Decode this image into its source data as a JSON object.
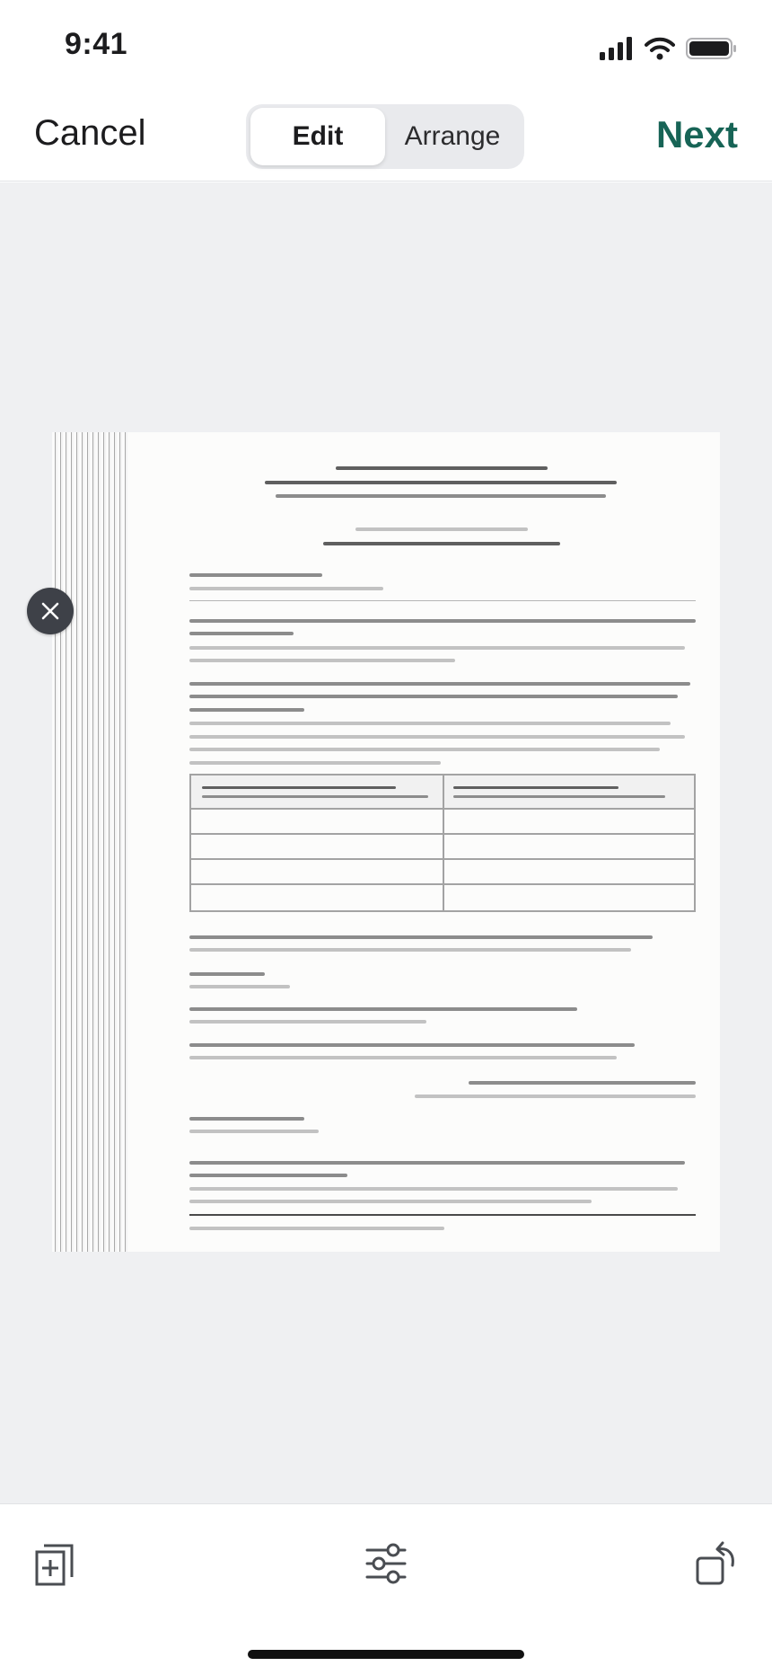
{
  "status_bar": {
    "time": "9:41"
  },
  "nav": {
    "cancel_label": "Cancel",
    "segments": [
      {
        "label": "Edit",
        "selected": true
      },
      {
        "label": "Arrange",
        "selected": false
      }
    ],
    "next_label": "Next",
    "accent_color": "#176456"
  },
  "scan_page": {
    "remove_icon": "close-icon",
    "content": "scanned document page (text not legible)"
  },
  "toolbar": {
    "icons": [
      "add-page-icon",
      "adjustments-icon",
      "rotate-icon"
    ]
  }
}
